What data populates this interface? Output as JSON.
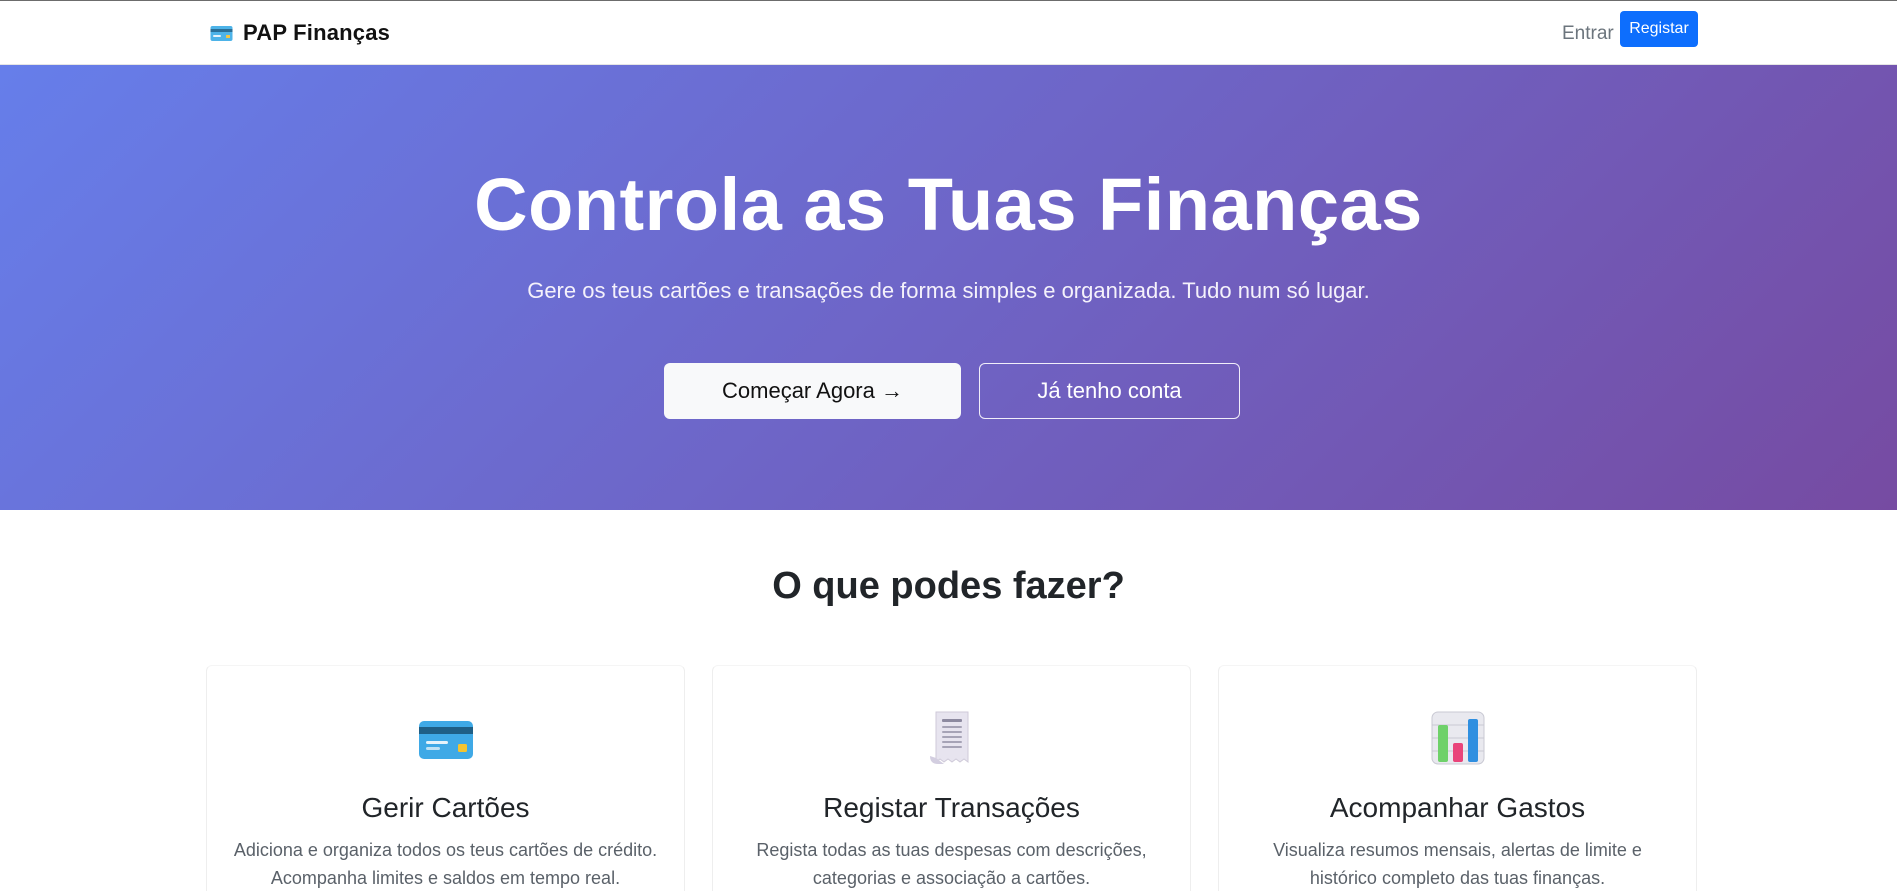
{
  "navbar": {
    "brand_text": "PAP Finanças",
    "brand_icon": "credit-card-icon",
    "login_label": "Entrar",
    "register_label": "Registar",
    "register_color": "#0d6efd"
  },
  "hero": {
    "title": "Controla as Tuas Finanças",
    "subtitle": "Gere os teus cartões e transações de forma simples e organizada. Tudo num só lugar.",
    "start_label": "Começar Agora →",
    "account_label": "Já tenho conta",
    "gradient_start": "#667eea",
    "gradient_end": "#764ba2"
  },
  "features": {
    "title": "O que podes fazer?",
    "cards": [
      {
        "icon": "credit-card-icon",
        "title": "Gerir Cartões",
        "desc": "Adiciona e organiza todos os teus cartões de crédito. Acompanha limites e saldos em tempo real."
      },
      {
        "icon": "receipt-icon",
        "title": "Registar Transações",
        "desc": "Regista todas as tuas despesas com descrições, categorias e associação a cartões."
      },
      {
        "icon": "bar-chart-icon",
        "title": "Acompanhar Gastos",
        "desc": "Visualiza resumos mensais, alertas de limite e histórico completo das tuas finanças."
      }
    ]
  }
}
